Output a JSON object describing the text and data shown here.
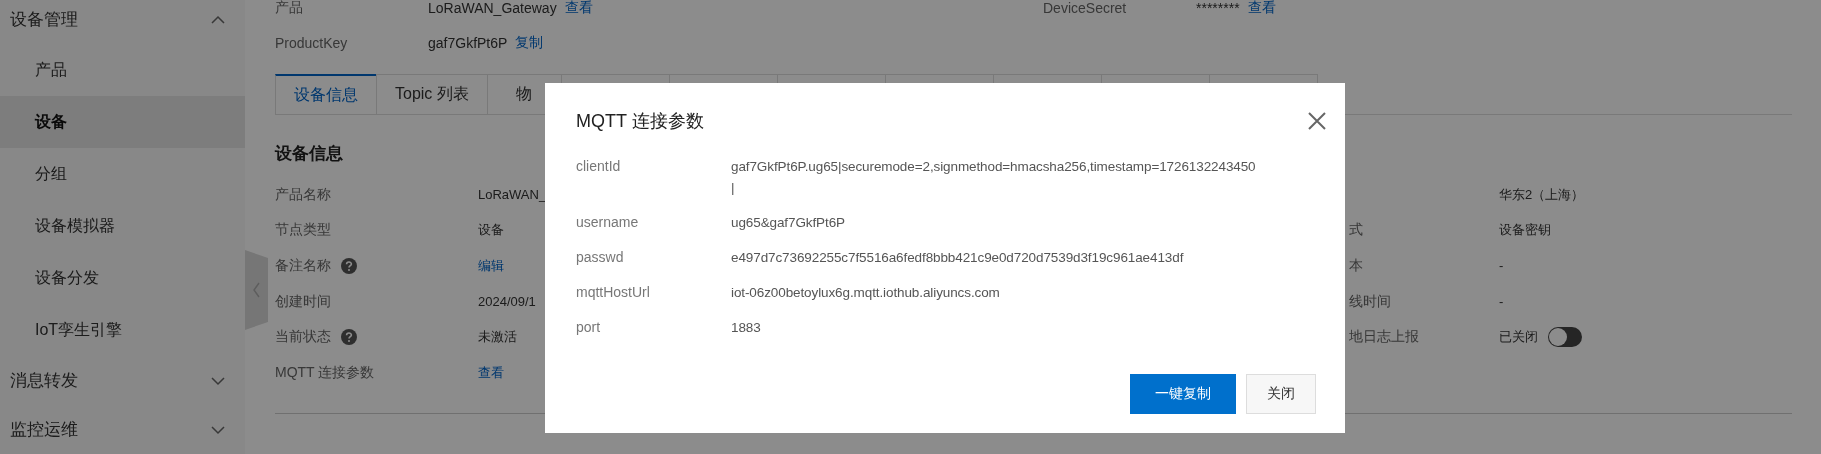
{
  "sidebar": {
    "groups": [
      {
        "label": "设备管理",
        "expanded": true,
        "items": [
          {
            "label": "产品",
            "selected": false
          },
          {
            "label": "设备",
            "selected": true
          },
          {
            "label": "分组",
            "selected": false
          },
          {
            "label": "设备模拟器",
            "selected": false
          },
          {
            "label": "设备分发",
            "selected": false
          },
          {
            "label": "IoT孪生引擎",
            "selected": false
          }
        ]
      },
      {
        "label": "消息转发",
        "expanded": false
      },
      {
        "label": "监控运维",
        "expanded": false
      }
    ]
  },
  "summary": [
    {
      "label": "产品",
      "value": "LoRaWAN_Gateway",
      "link": "查看"
    },
    {
      "label": "DeviceSecret",
      "value": "********",
      "link": "查看"
    },
    {
      "label": "ProductKey",
      "value": "gaf7GkfPt6P",
      "link": "复制"
    }
  ],
  "tabs": [
    {
      "label": "设备信息",
      "selected": true
    },
    {
      "label": "Topic 列表",
      "selected": false
    },
    {
      "label": "物",
      "selected": false
    }
  ],
  "section_title": "设备信息",
  "details_left": [
    {
      "label": "产品名称",
      "value": "LoRaWAN_"
    },
    {
      "label": "节点类型",
      "value": "设备"
    },
    {
      "label": "备注名称",
      "help": true,
      "link": "编辑"
    },
    {
      "label": "创建时间",
      "value": "2024/09/1"
    },
    {
      "label": "当前状态",
      "help": true,
      "value": "未激活"
    },
    {
      "label": "MQTT 连接参数",
      "link": "查看"
    }
  ],
  "details_right": [
    {
      "value": "华东2（上海）"
    },
    {
      "label": "式",
      "value": "设备密钥"
    },
    {
      "label": "本",
      "value": "-"
    },
    {
      "label": "线时间",
      "value": "-"
    },
    {
      "label": "地日志上报",
      "value": "已关闭",
      "toggle": {
        "on": false
      }
    }
  ],
  "dialog": {
    "title": "MQTT 连接参数",
    "rows": [
      {
        "label": "clientId",
        "value_lines": [
          "gaf7GkfPt6P.ug65|securemode=2,signmethod=hmacsha256,timestamp=1726132243450",
          "|"
        ]
      },
      {
        "label": "username",
        "value_lines": [
          "ug65&gaf7GkfPt6P"
        ]
      },
      {
        "label": "passwd",
        "value_lines": [
          "e497d7c73692255c7f5516a6fedf8bbb421c9e0d720d7539d3f19c961ae413df"
        ]
      },
      {
        "label": "mqttHostUrl",
        "value_lines": [
          "iot-06z00betoylux6g.mqtt.iothub.aliyuncs.com"
        ]
      },
      {
        "label": "port",
        "value_lines": [
          "1883"
        ]
      }
    ],
    "buttons": [
      {
        "label": "一键复制",
        "kind": "primary"
      },
      {
        "label": "关闭",
        "kind": "normal"
      }
    ]
  }
}
